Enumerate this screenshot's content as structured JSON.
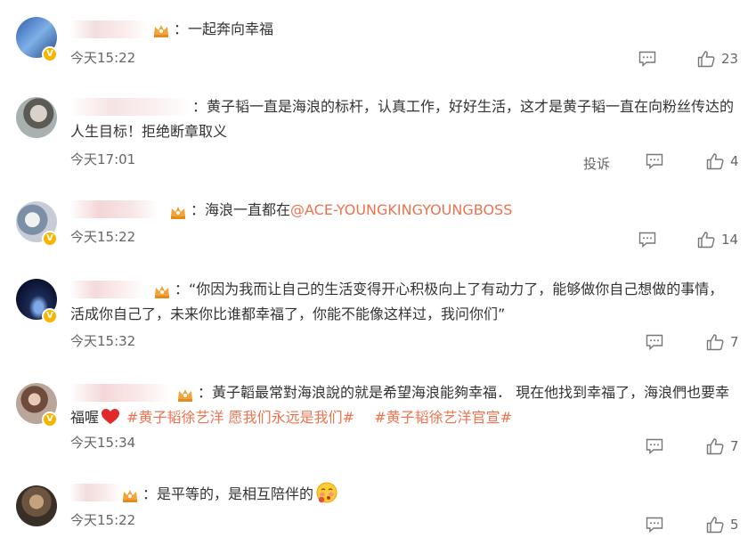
{
  "comments": [
    {
      "text": "：一起奔向幸福",
      "time": "今天15:22",
      "likes": "23",
      "avatar_color": "#3b6fb6"
    },
    {
      "text_line1": "：黄子韬一直是海浪的标杆，认真工作，好好生活，这才是黄子韬一直在向粉丝传达的",
      "text_line2": "人生目标！拒绝断章取义",
      "time": "今天17:01",
      "report": "投诉",
      "likes": "4",
      "avatar_color": "#7b8a86"
    },
    {
      "text_prefix": "：海浪一直都在",
      "mention": "@ACE-YOUNGKINGYOUNGBOSS",
      "time": "今天15:22",
      "likes": "14",
      "avatar_color": "#6a7d9b"
    },
    {
      "text_line1": "：“你因为我而让自己的生活变得开心积极向上了有动力了，能够做你自己想做的事情，",
      "text_line2": "活成你自己了，未来你比谁都幸福了，你能不能像这样过，我问你们”",
      "time": "今天15:32",
      "likes": "7",
      "avatar_color": "#1d2a4f"
    },
    {
      "text_line1": "：黃子韜最常對海浪說的就是希望海浪能夠幸福． 現在他找到幸福了，海浪們也要幸",
      "text_line2_prefix": "福喔",
      "topic1": "#黄子韬徐艺洋 愿我们永远是我们#",
      "topic2": "#黄子韬徐艺洋官宣#",
      "time": "今天15:34",
      "likes": "7",
      "avatar_color": "#8a6b5c"
    },
    {
      "text": "：是平等的，是相互陪伴的",
      "time": "今天15:22",
      "likes": "5",
      "avatar_color": "#5a4a3a"
    }
  ],
  "colors": {
    "accent": "#eb7350",
    "badge": "#f7b500",
    "heart": "#e02a2a",
    "crown": "#f2a33a"
  },
  "icons": [
    "comment-icon",
    "thumbs-up-icon",
    "crown-icon",
    "verified-badge-icon",
    "heart-icon",
    "blush-emoji-icon"
  ]
}
